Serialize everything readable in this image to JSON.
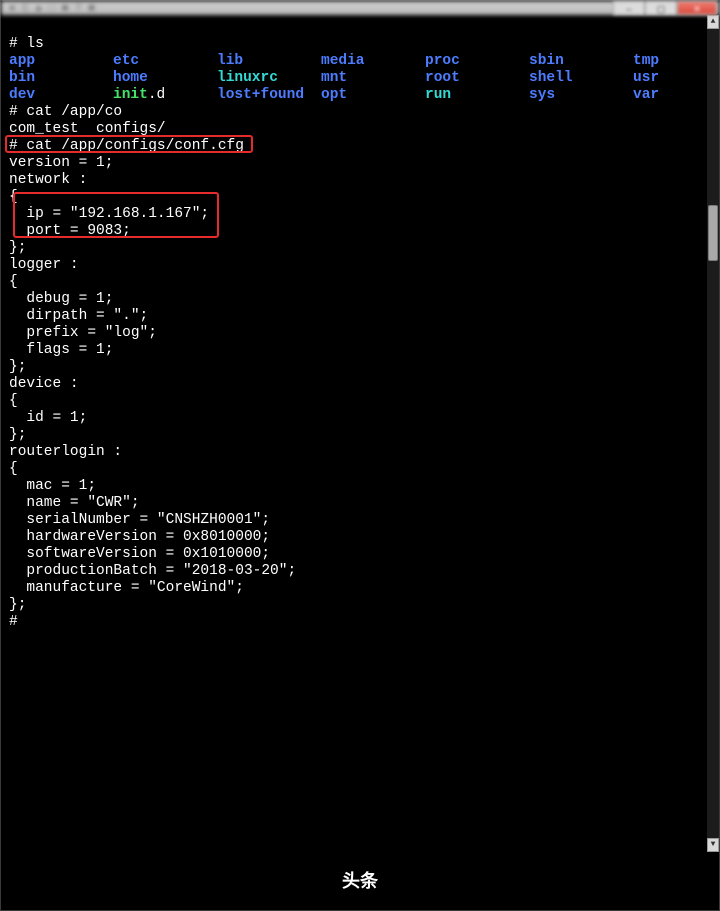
{
  "window": {
    "min_glyph": "—",
    "max_glyph": "▢",
    "close_glyph": "✕"
  },
  "ls": {
    "row1": [
      "app",
      "etc",
      "lib",
      "media",
      "proc",
      "sbin",
      "tmp"
    ],
    "row2": [
      "bin",
      "home",
      "linuxrc",
      "mnt",
      "root",
      "shell",
      "usr"
    ],
    "row3_a": [
      "dev"
    ],
    "row3_init": "init",
    "row3_dot_d": ".d",
    "row3_b": [
      "lost+found",
      "opt",
      "run",
      "sys",
      "var"
    ]
  },
  "prompt_top": "# ls",
  "lines": {
    "l1": "# cat /app/co",
    "l2": "com_test  configs/",
    "l3": "# cat /app/configs/conf.cfg",
    "l4": "version = 1;",
    "l5": "network :",
    "l6": "{",
    "l7": "  ip = \"192.168.1.167\";",
    "l8": "  port = 9083;",
    "l9": "};",
    "l10": "logger :",
    "l11": "{",
    "l12": "  debug = 1;",
    "l13": "  dirpath = \".\";",
    "l14": "  prefix = \"log\";",
    "l15": "  flags = 1;",
    "l16": "};",
    "l17": "device :",
    "l18": "{",
    "l19": "  id = 1;",
    "l20": "};",
    "l21": "routerlogin :",
    "l22": "{",
    "l23": "  mac = 1;",
    "l24": "  name = \"CWR\";",
    "l25": "  serialNumber = \"CNSHZH0001\";",
    "l26": "  hardwareVersion = 0x8010000;",
    "l27": "  softwareVersion = 0x1010000;",
    "l28": "  productionBatch = \"2018-03-20\";",
    "l29": "  manufacture = \"CoreWind\";",
    "l30": "};",
    "l31": "#"
  },
  "footer": {
    "label": "头条"
  },
  "scrollbar": {
    "up": "▲",
    "down": "▼"
  }
}
